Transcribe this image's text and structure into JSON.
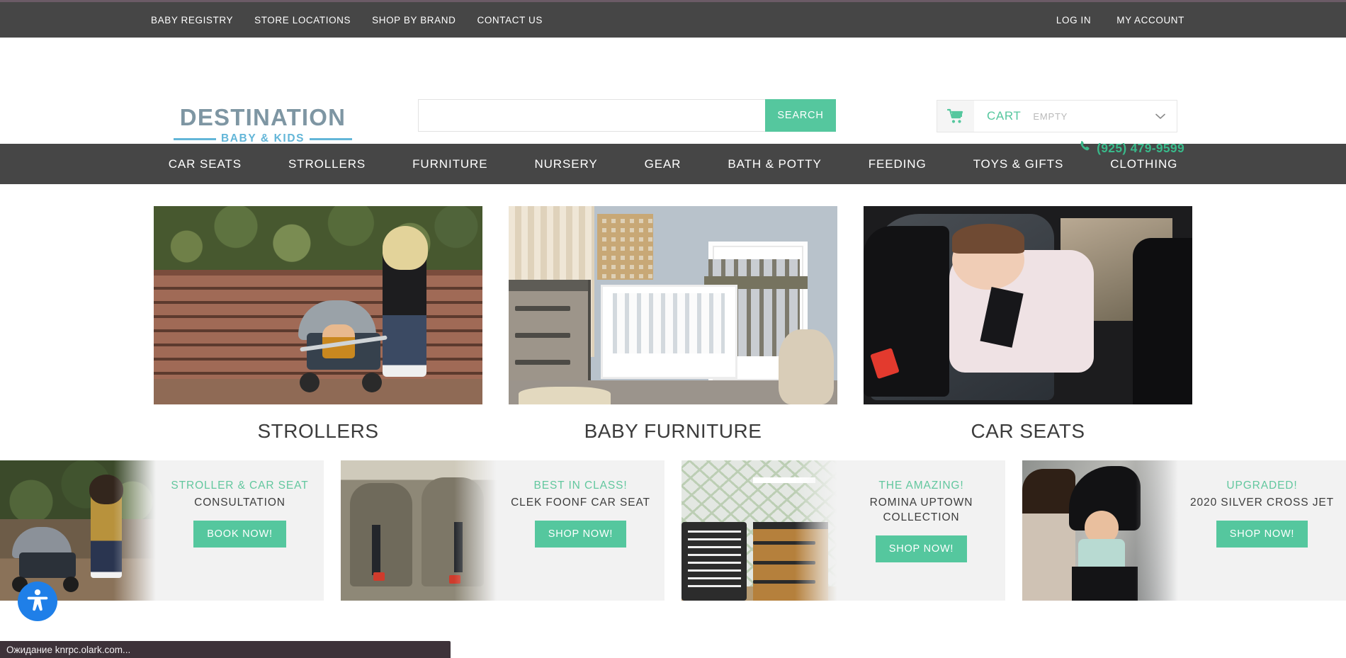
{
  "utility_nav": {
    "left_links": [
      {
        "label": "BABY REGISTRY"
      },
      {
        "label": "STORE LOCATIONS"
      },
      {
        "label": "SHOP BY BRAND"
      },
      {
        "label": "CONTACT US"
      }
    ],
    "right_links": [
      {
        "label": "LOG IN"
      },
      {
        "label": "MY ACCOUNT"
      }
    ]
  },
  "logo": {
    "main": "DESTINATION",
    "sub": "BABY & KIDS"
  },
  "search": {
    "value": "",
    "placeholder": "",
    "button_label": "SEARCH"
  },
  "cart": {
    "icon": "shopping-cart-icon",
    "label": "CART",
    "status": "EMPTY",
    "chevron": "⌄"
  },
  "phone": {
    "icon": "phone-icon",
    "number": "(925) 479-9599"
  },
  "main_nav": {
    "items": [
      {
        "label": "CAR SEATS"
      },
      {
        "label": "STROLLERS"
      },
      {
        "label": "FURNITURE"
      },
      {
        "label": "NURSERY"
      },
      {
        "label": "GEAR"
      },
      {
        "label": "BATH & POTTY"
      },
      {
        "label": "FEEDING"
      },
      {
        "label": "TOYS & GIFTS"
      },
      {
        "label": "CLOTHING"
      }
    ]
  },
  "categories": [
    {
      "caption": "STROLLERS",
      "image_alt": "woman-pushing-stroller-by-wooden-fence"
    },
    {
      "caption": "BABY FURNITURE",
      "image_alt": "white-crib-and-dresser-in-nursery"
    },
    {
      "caption": "CAR SEATS",
      "image_alt": "baby-smiling-in-rear-facing-car-seat"
    }
  ],
  "promos": [
    {
      "kicker": "STROLLER & CAR SEAT",
      "title": "CONSULTATION",
      "button_label": "BOOK NOW!",
      "image_alt": "mother-walking-with-stroller-outdoors"
    },
    {
      "kicker": "BEST IN CLASS!",
      "title": "CLEK FOONF CAR SEAT",
      "button_label": "SHOP NOW!",
      "image_alt": "two-car-seats-installed-in-vehicle"
    },
    {
      "kicker": "THE AMAZING!",
      "title": "ROMINA UPTOWN COLLECTION",
      "button_label": "SHOP NOW!",
      "image_alt": "wooden-dresser-and-crib-with-leaf-wallpaper"
    },
    {
      "kicker": "UPGRADED!",
      "title": "2020 SILVER CROSS JET",
      "button_label": "SHOP NOW!",
      "image_alt": "mother-leaning-over-baby-in-stroller"
    }
  ],
  "accessibility_widget": {
    "icon": "accessibility-person-icon"
  },
  "browser_status": {
    "text": "Ожидание knrpc.olark.com..."
  },
  "colors": {
    "accent_green": "#55c79e",
    "phone_green": "#39b98a",
    "nav_dark": "#464646",
    "logo_gray_blue": "#7e96a3",
    "logo_blue": "#63b6d8",
    "promo_bg": "#f2f2f2",
    "a11y_blue": "#1f7fe8",
    "status_bar_bg": "#3d3239"
  }
}
